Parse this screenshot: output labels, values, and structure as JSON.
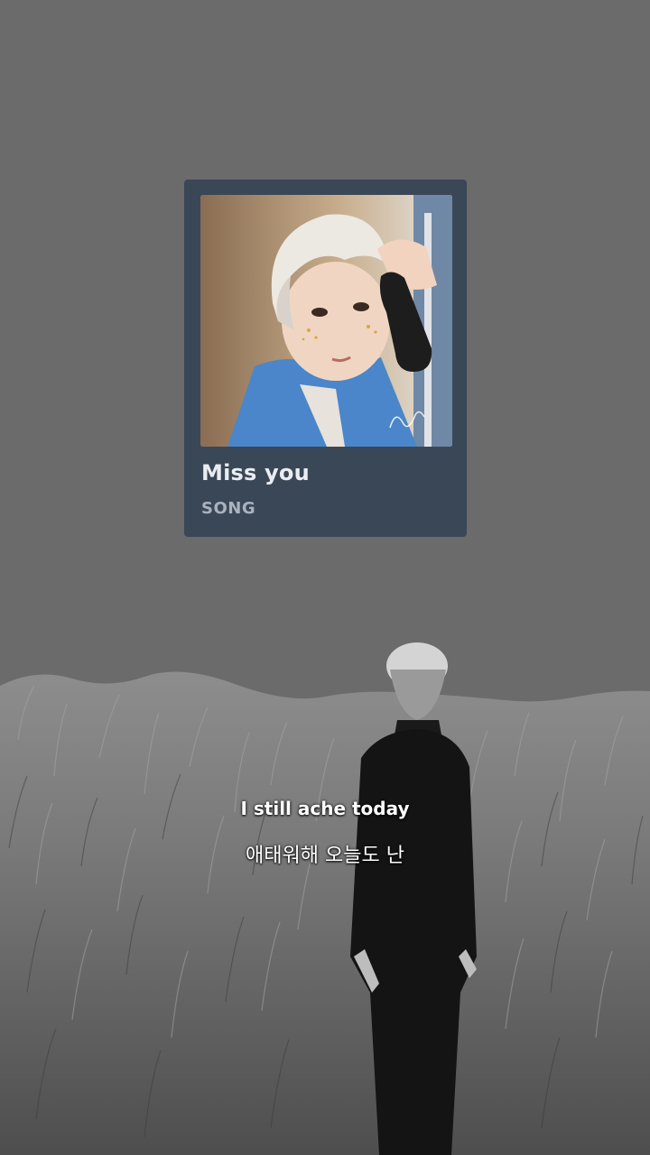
{
  "song_card": {
    "title": "Miss you",
    "type": "SONG"
  },
  "lyrics": {
    "english": "I still ache today",
    "korean": "애태워해 오늘도 난"
  },
  "colors": {
    "background": "#6b6b6b",
    "card": "#3a4756",
    "title_text": "#e9edf2",
    "subtitle_text": "#a9b2bd",
    "lyric_text": "#ffffff"
  }
}
